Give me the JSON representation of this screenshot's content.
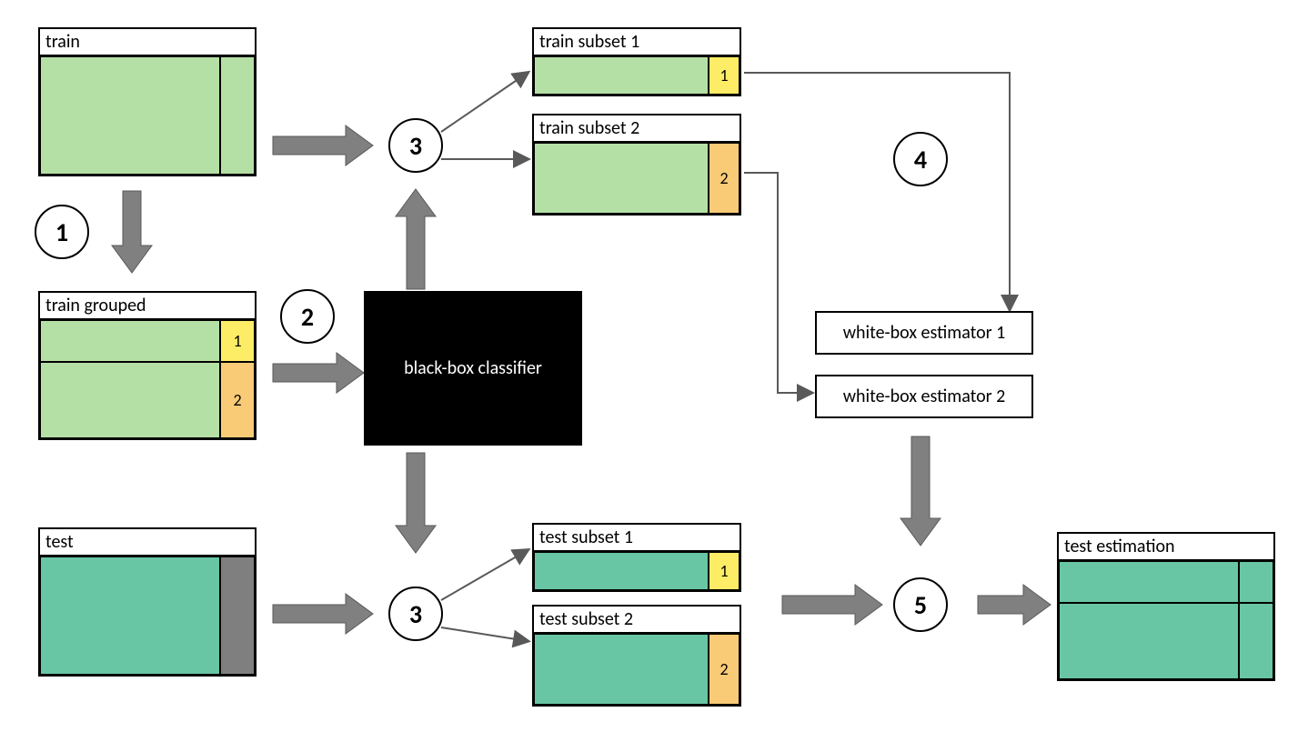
{
  "boxes": {
    "train": "train",
    "train_grouped": "train grouped",
    "train_subset_1": "train subset 1",
    "train_subset_2": "train subset 2",
    "test": "test",
    "test_subset_1": "test subset 1",
    "test_subset_2": "test subset 2",
    "test_estimation": "test estimation",
    "black_box": "black-box classifier",
    "white_box_1": "white-box estimator 1",
    "white_box_2": "white-box estimator 2"
  },
  "steps": {
    "s1": "1",
    "s2": "2",
    "s3a": "3",
    "s3b": "3",
    "s4": "4",
    "s5": "5"
  },
  "tag": {
    "num1": "1",
    "num2": "2"
  },
  "colors": {
    "lightgreen": "#b5e0a5",
    "teal": "#68c6a4",
    "yellow": "#fdec65",
    "orange": "#f9cb76",
    "gray": "#7f7f7f",
    "black": "#000000",
    "arrow": "#808080"
  }
}
